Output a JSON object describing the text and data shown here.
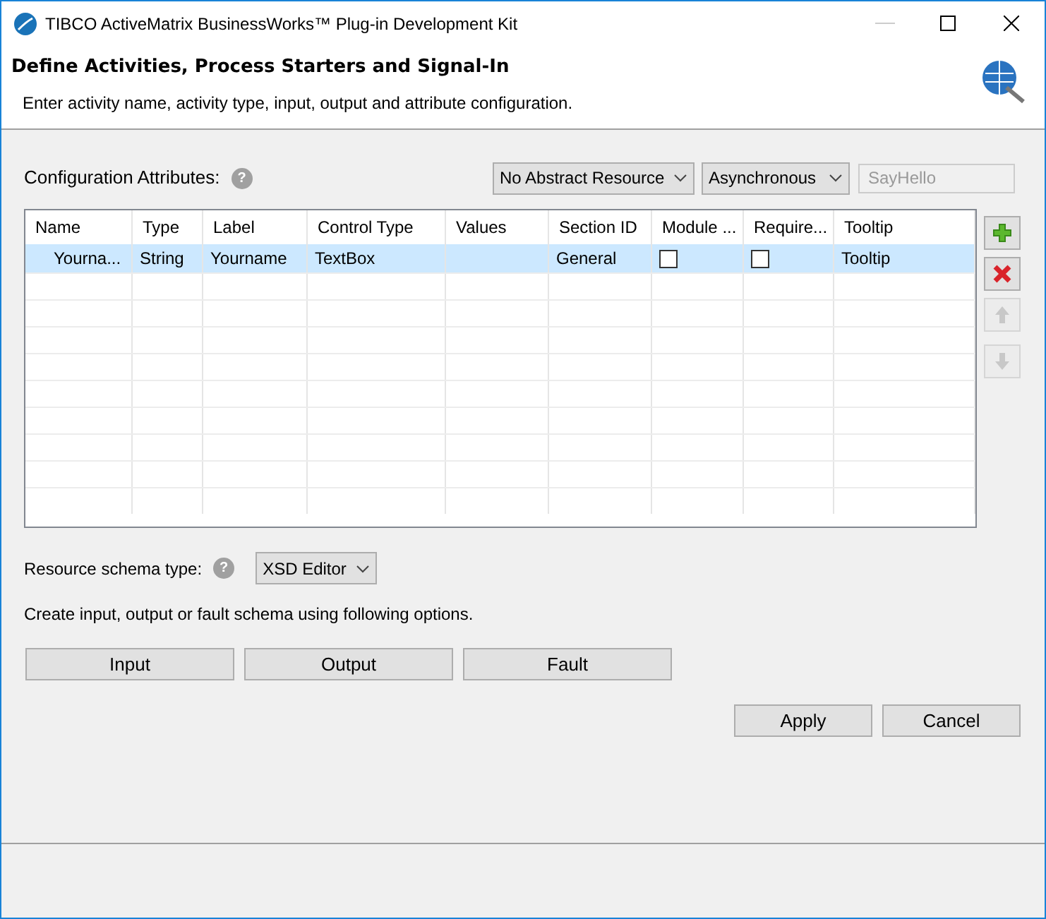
{
  "window": {
    "title": "TIBCO ActiveMatrix BusinessWorks™ Plug-in Development Kit"
  },
  "header": {
    "title": "Define Activities, Process Starters and Signal-In",
    "subtitle": "Enter activity name, activity type, input, output and attribute configuration."
  },
  "config": {
    "label": "Configuration Attributes:",
    "help": "?",
    "resource_select": "No Abstract Resource",
    "mode_select": "Asynchronous",
    "name_field": {
      "value": "SayHello",
      "disabled": true
    }
  },
  "table": {
    "columns": [
      "Name",
      "Type",
      "Label",
      "Control Type",
      "Values",
      "Section ID",
      "Module ...",
      "Require...",
      "Tooltip"
    ],
    "rows": [
      {
        "selected": true,
        "name": "Yourna...",
        "type": "String",
        "label": "Yourname",
        "control_type": "TextBox",
        "section_id": "General",
        "module_checked": false,
        "required_checked": false,
        "tooltip": "Tooltip"
      }
    ]
  },
  "side_buttons": [
    {
      "kind": "add",
      "disabled": false
    },
    {
      "kind": "remove",
      "disabled": false
    },
    {
      "kind": "up",
      "disabled": true
    },
    {
      "kind": "down",
      "disabled": true
    }
  ],
  "schema": {
    "label": "Resource schema type:",
    "help": "?",
    "select": "XSD Editor",
    "hint": "Create input, output or fault schema using following options.",
    "buttons": [
      "Input",
      "Output",
      "Fault"
    ]
  },
  "footer_buttons": [
    "Apply",
    "Cancel"
  ]
}
